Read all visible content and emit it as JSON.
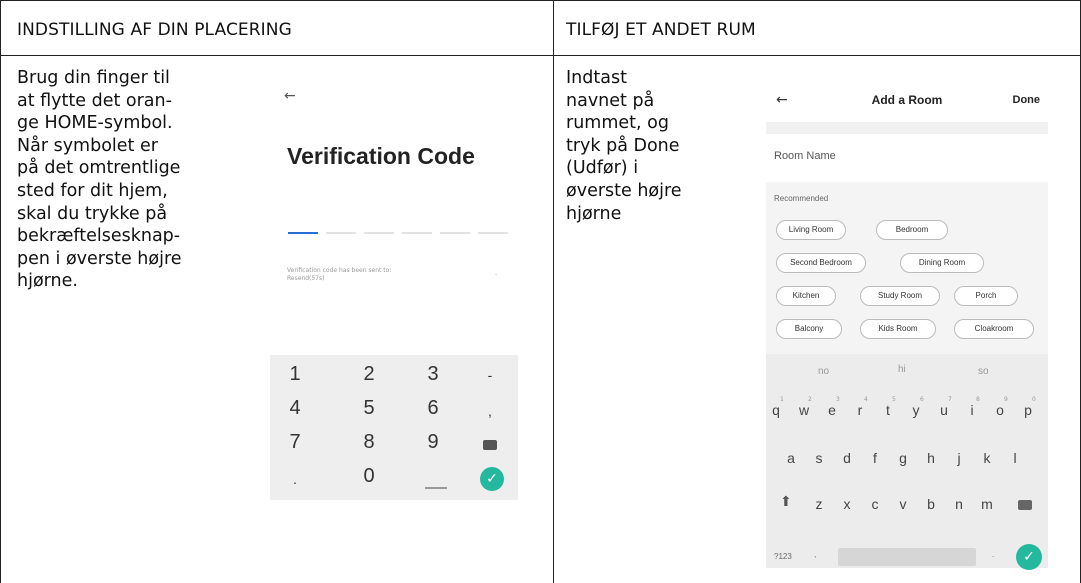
{
  "left": {
    "heading": "INDSTILLING AF DIN PLACERING",
    "description": "Brug din finger til\nat flytte det oran-\nge HOME-symbol.\nNår symbolet er\npå det omtrentlige\nsted for dit hjem,\nskal du trykke på\nbekræftelsesknap-\npen i øverste højre\nhjørne.",
    "phone": {
      "back": "←",
      "title": "Verification Code",
      "note": "Verification code has been sent to:\nResend(57s)",
      "keys": [
        "1",
        "2",
        "3",
        "-",
        "4",
        "5",
        "6",
        ",",
        "7",
        "8",
        "9",
        ".",
        "0"
      ]
    }
  },
  "right": {
    "heading": "TILFØJ ET ANDET RUM",
    "description": "Indtast\nnavnet på\nrummet, og\ntryk på Done\n(Udfør) i\nøverste højre\nhjørne",
    "phone": {
      "back": "←",
      "title": "Add a Room",
      "done": "Done",
      "room_name": "Room Name",
      "recommended": "Recommended",
      "chips": [
        "Living Room",
        "Bedroom",
        "Second Bedroom",
        "Dining Room",
        "Kitchen",
        "Study Room",
        "Porch",
        "Balcony",
        "Kids Room",
        "Cloakroom"
      ],
      "suggestions": [
        "no",
        "hi",
        "so"
      ],
      "row1": [
        "q",
        "w",
        "e",
        "r",
        "t",
        "y",
        "u",
        "i",
        "o",
        "p"
      ],
      "row1_nums": [
        "1",
        "2",
        "3",
        "4",
        "5",
        "6",
        "7",
        "8",
        "9",
        "0"
      ],
      "row2": [
        "a",
        "s",
        "d",
        "f",
        "g",
        "h",
        "j",
        "k",
        "l"
      ],
      "row3": [
        "z",
        "x",
        "c",
        "v",
        "b",
        "n",
        "m"
      ],
      "sym_key": "?123",
      "comma": ",",
      "period": "."
    }
  },
  "colors": {
    "accent_blue": "#2b6fd6",
    "confirm_green": "#24b89f"
  }
}
